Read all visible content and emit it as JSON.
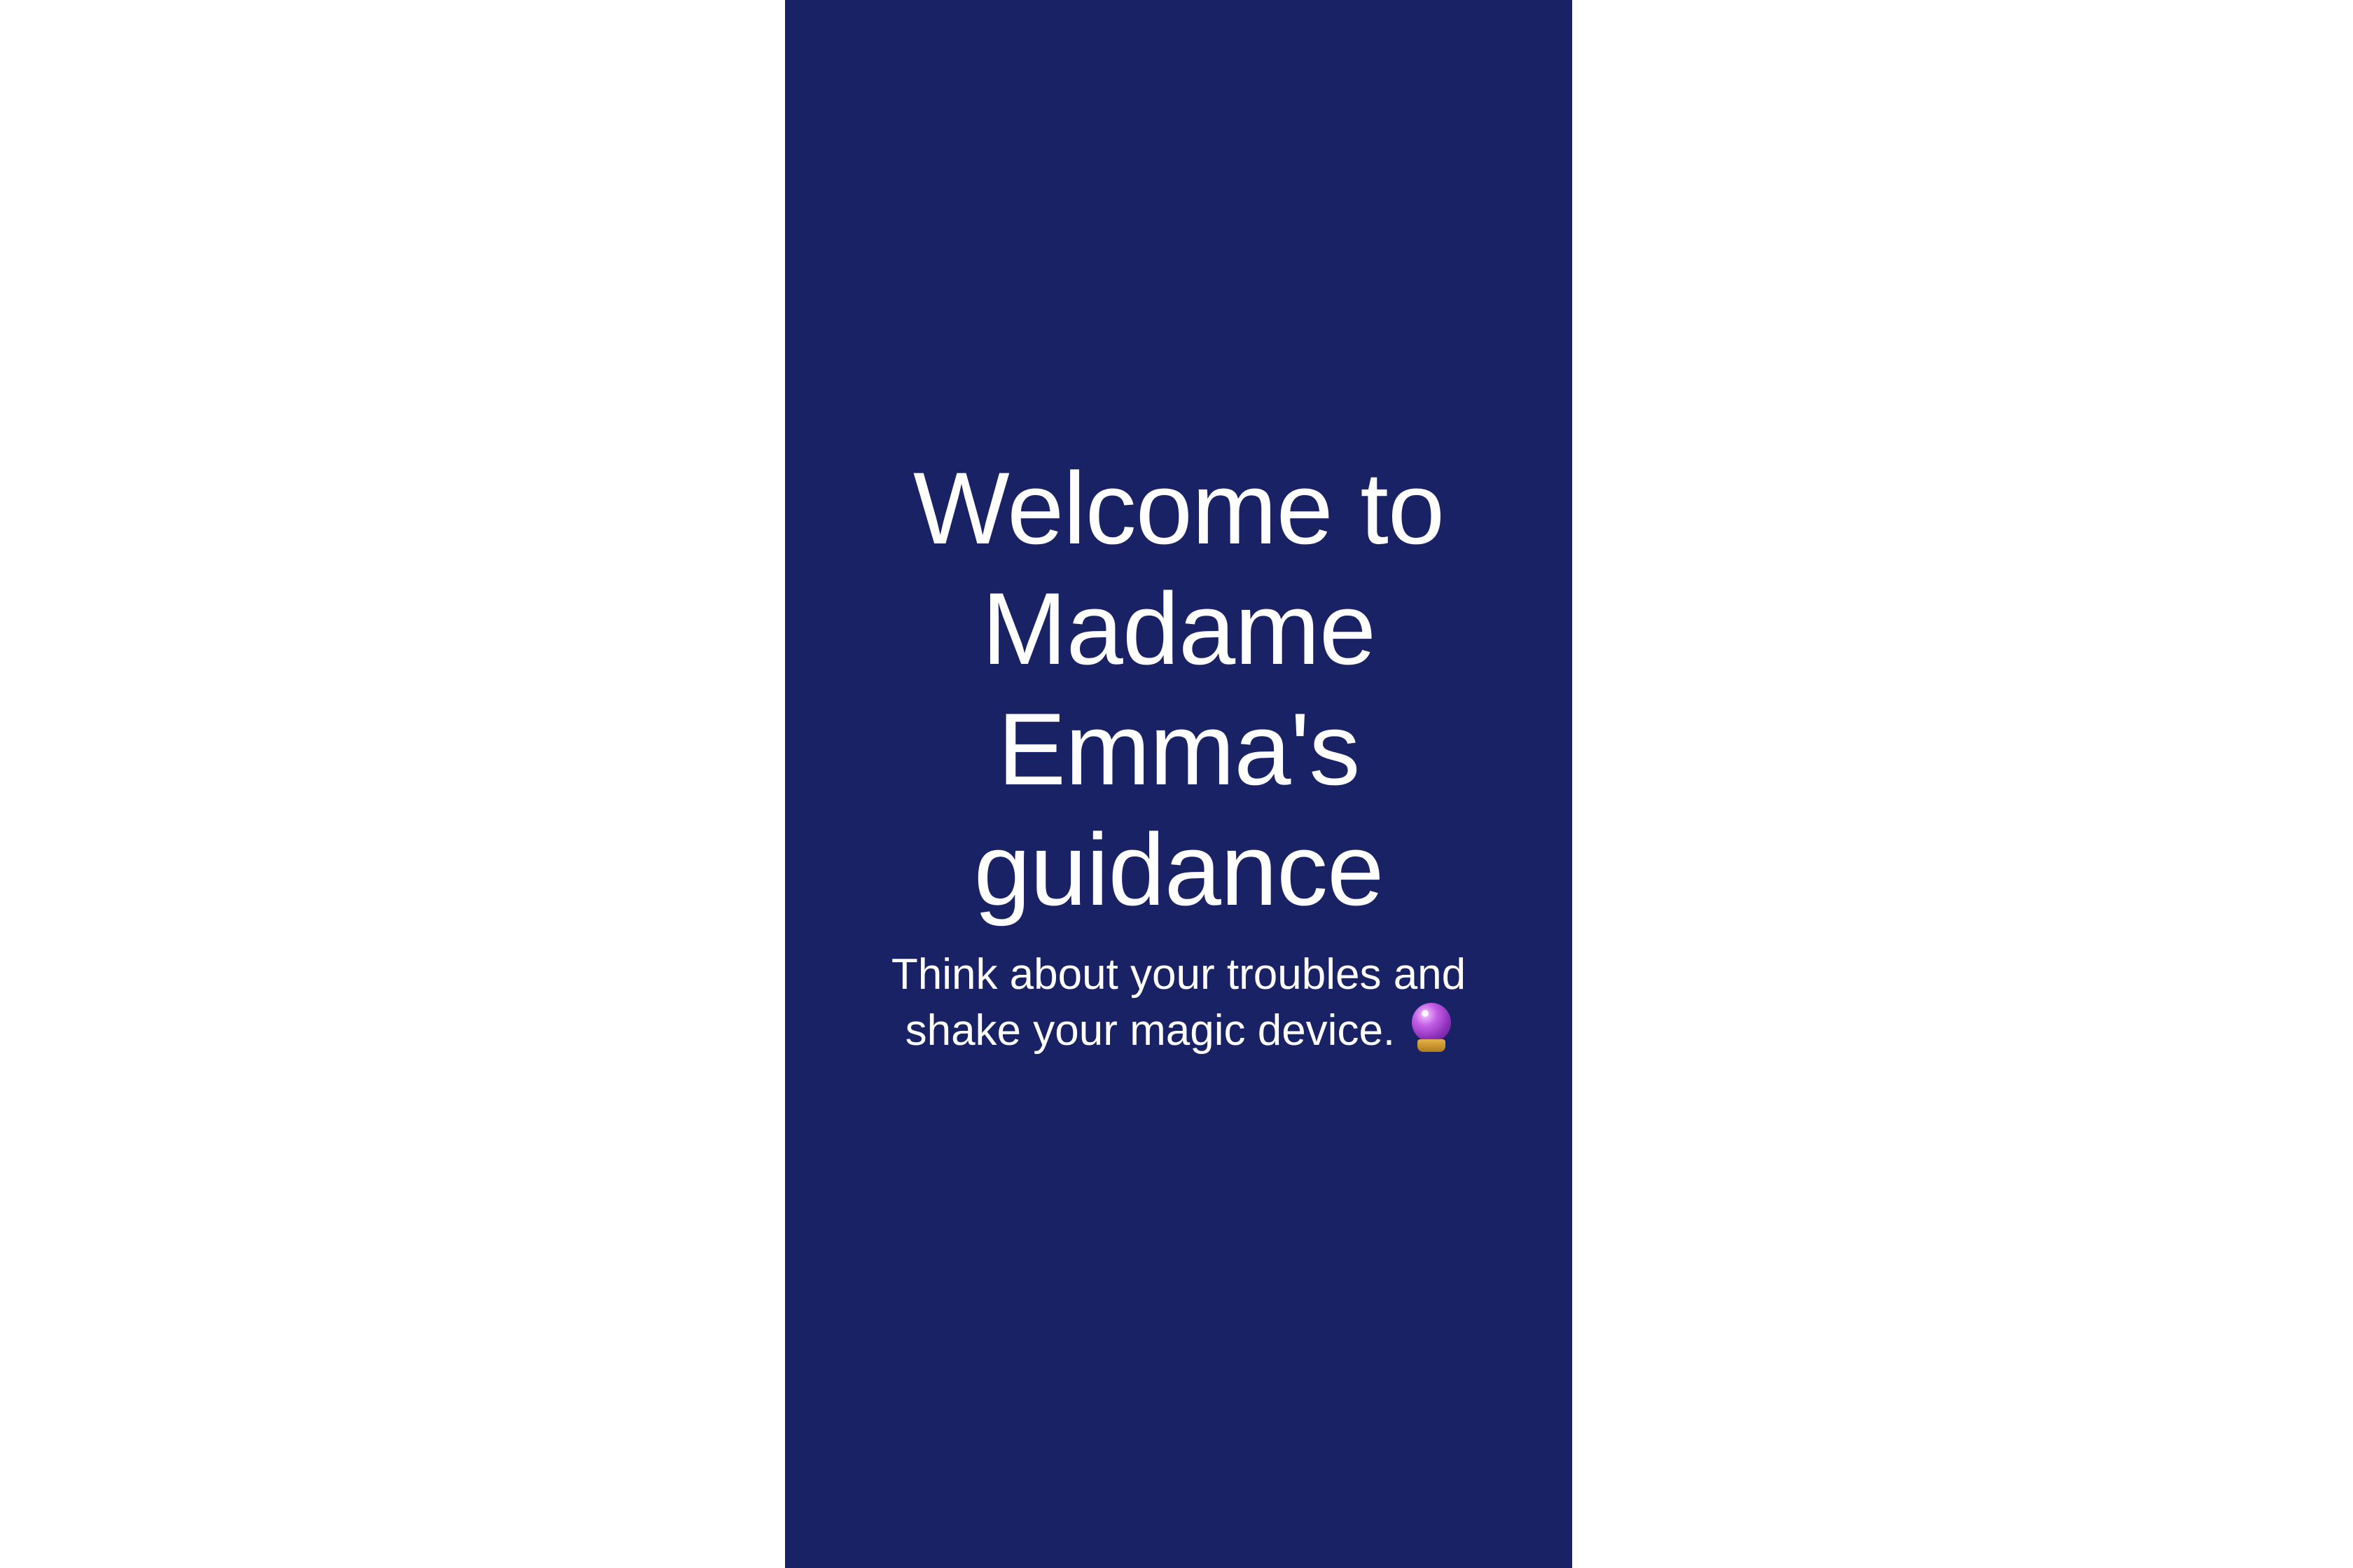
{
  "colors": {
    "screen_background": "#1a2266",
    "outer_background": "#ffffff",
    "text": "#ffffff"
  },
  "welcome": {
    "title": "Welcome to Madame Emma's guidance",
    "subtitle": "Think about your troubles and shake your magic device.",
    "subtitle_icon": "crystal-ball-icon"
  }
}
